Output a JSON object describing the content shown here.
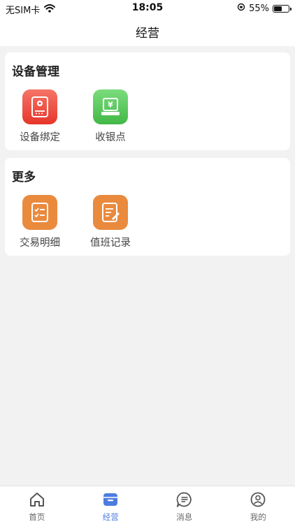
{
  "status_bar": {
    "carrier": "无SIM卡",
    "time": "18:05",
    "battery": "55%",
    "battery_level": 0.55
  },
  "header": {
    "title": "经营"
  },
  "sections": [
    {
      "title": "设备管理",
      "items": [
        {
          "label": "设备绑定",
          "icon": "device-icon",
          "color": "#eb4a3c"
        },
        {
          "label": "收银点",
          "icon": "cash-register-icon",
          "color": "#58c95a"
        }
      ]
    },
    {
      "title": "更多",
      "items": [
        {
          "label": "交易明细",
          "icon": "checklist-icon",
          "color": "#ea8a3d"
        },
        {
          "label": "值班记录",
          "icon": "note-edit-icon",
          "color": "#ea8a3d"
        }
      ]
    }
  ],
  "tabbar": {
    "items": [
      {
        "label": "首页",
        "icon": "home-icon"
      },
      {
        "label": "经营",
        "icon": "business-icon",
        "active": true
      },
      {
        "label": "消息",
        "icon": "message-icon"
      },
      {
        "label": "我的",
        "icon": "profile-icon"
      }
    ],
    "active_color": "#4d7ce0"
  }
}
